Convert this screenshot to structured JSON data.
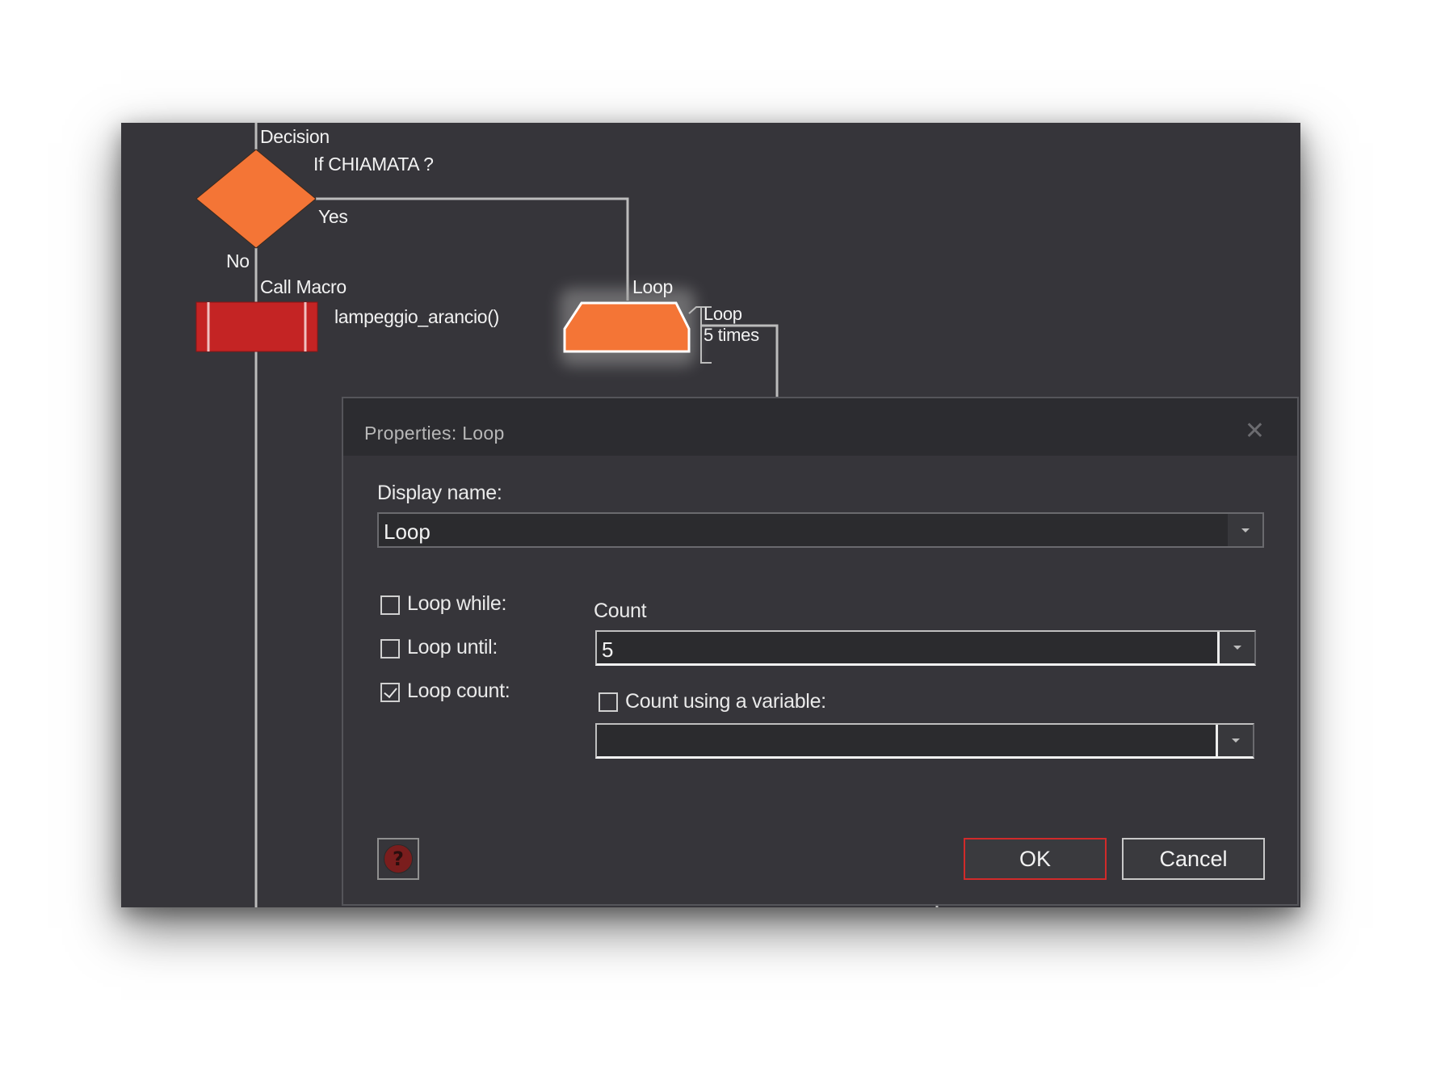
{
  "flowchart": {
    "decision": {
      "type_label": "Decision",
      "condition": "If  CHIAMATA ?",
      "yes_label": "Yes",
      "no_label": "No",
      "color": "#f47536"
    },
    "call_macro": {
      "type_label": "Call Macro",
      "name": "lampeggio_arancio()",
      "color": "#c42424"
    },
    "loop": {
      "type_label": "Loop",
      "side_label": "Loop",
      "side_count": "5 times",
      "color": "#f47536"
    }
  },
  "dialog": {
    "title": "Properties: Loop",
    "close_icon": "close-icon",
    "display_name_label": "Display name:",
    "display_name_value": "Loop",
    "options": [
      {
        "label": "Loop while:",
        "checked": false
      },
      {
        "label": "Loop until:",
        "checked": false
      },
      {
        "label": "Loop count:",
        "checked": true
      }
    ],
    "count_label": "Count",
    "count_value": "5",
    "count_using_variable_label": "Count using a variable:",
    "count_using_variable_checked": false,
    "variable_value": "",
    "help_icon": "help-icon",
    "ok_label": "OK",
    "cancel_label": "Cancel",
    "accent_color": "#d12a2a"
  }
}
